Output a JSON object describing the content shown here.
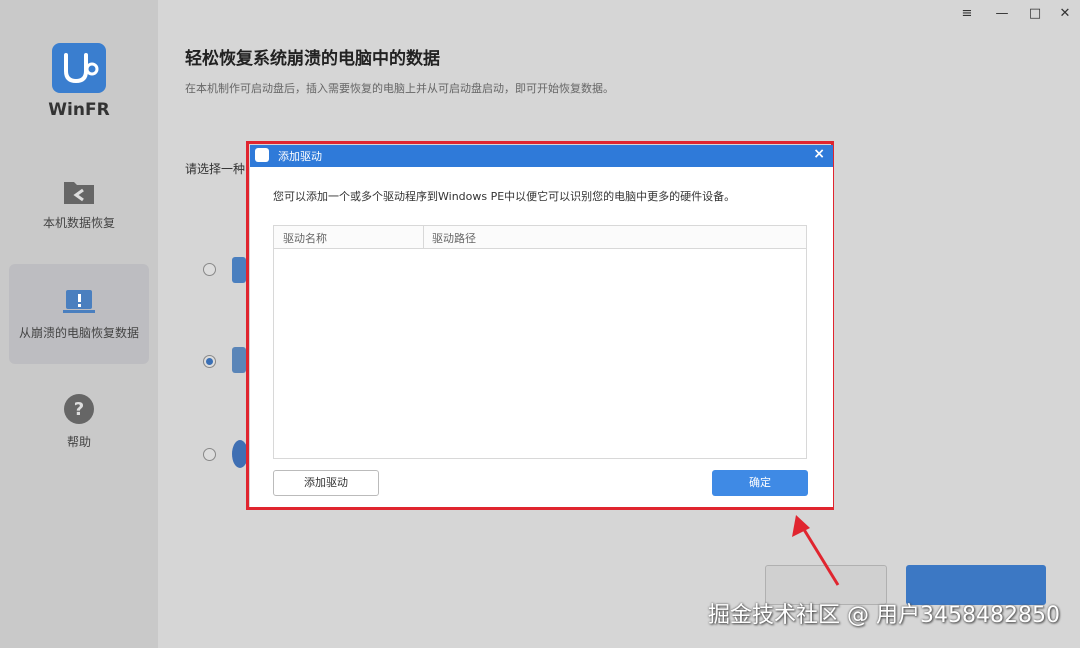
{
  "app": {
    "name": "WinFR"
  },
  "sidebar": {
    "items": [
      {
        "label": "本机数据恢复"
      },
      {
        "label": "从崩溃的电脑恢复数据"
      },
      {
        "label": "帮助"
      }
    ]
  },
  "window_controls": {
    "menu": "≡",
    "minimize": "—",
    "maximize": "□",
    "close": "✕"
  },
  "main": {
    "title": "轻松恢复系统崩溃的电脑中的数据",
    "subtitle": "在本机制作可启动盘后，插入需要恢复的电脑上并从可启动盘启动，即可开始恢复数据。",
    "choose_label": "请选择一种"
  },
  "dialog": {
    "title": "添加驱动",
    "description": "您可以添加一个或多个驱动程序到Windows PE中以便它可以识别您的电脑中更多的硬件设备。",
    "columns": [
      "驱动名称",
      "驱动路径"
    ],
    "add_button": "添加驱动",
    "ok_button": "确定",
    "close_glyph": "×"
  },
  "watermark": "掘金技术社区 @ 用户3458482850",
  "colors": {
    "accent": "#2f7ad9",
    "highlight": "#e0252f",
    "primary_button": "#3f8ae5"
  }
}
